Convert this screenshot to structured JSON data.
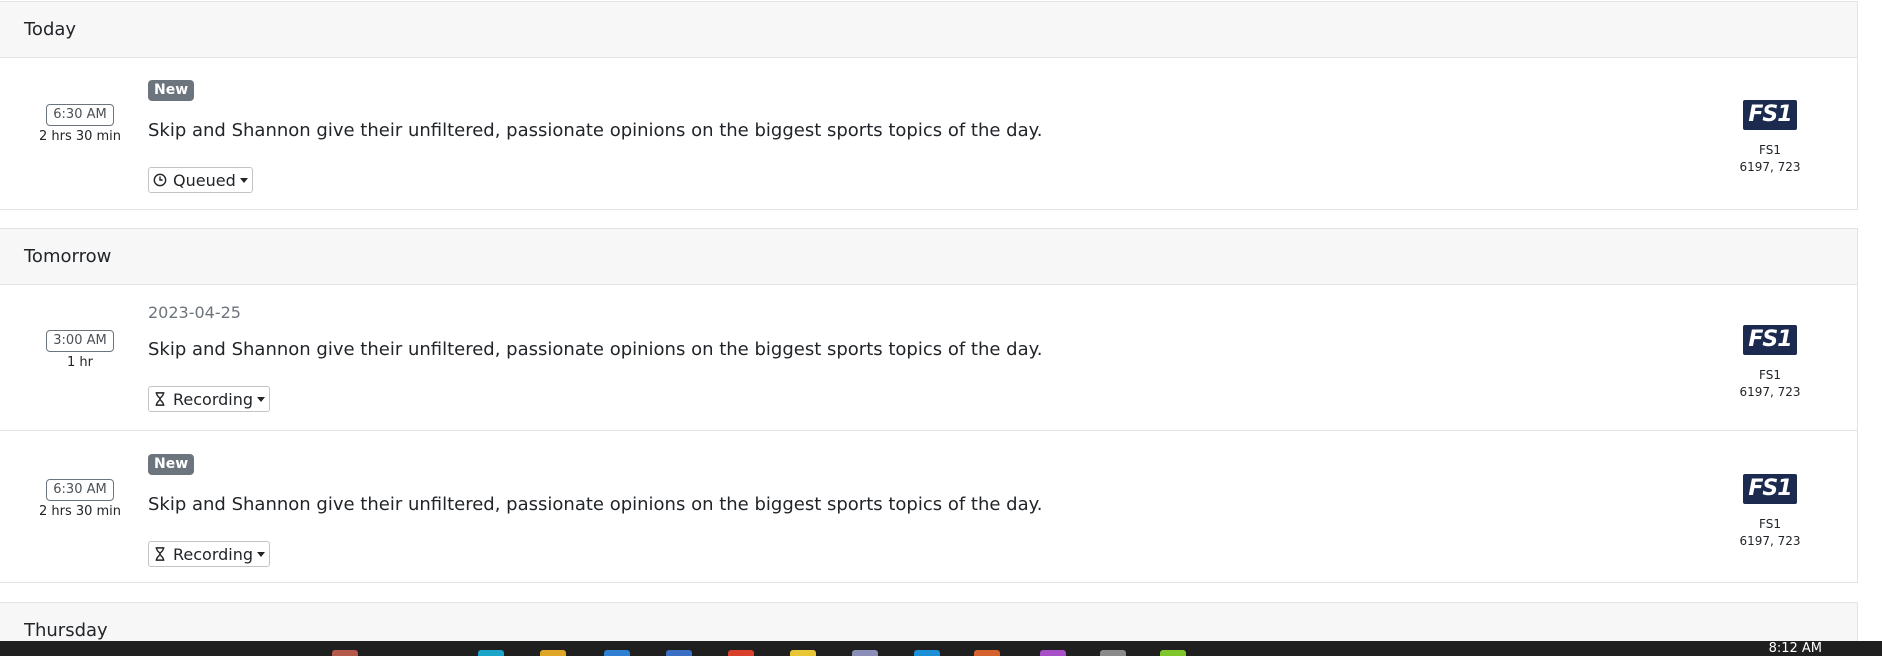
{
  "sections": [
    {
      "header": "Today",
      "rows": [
        {
          "time": "6:30 AM",
          "duration": "2 hrs 30 min",
          "tag": "New",
          "description": "Skip and Shannon give their unfiltered, passionate opinions on the biggest sports topics of the day.",
          "status": "Queued",
          "status_icon": "clock-icon",
          "channel_logo": "FS1",
          "channel_name": "FS1",
          "channel_numbers": "6197, 723"
        }
      ]
    },
    {
      "header": "Tomorrow",
      "rows": [
        {
          "time": "3:00 AM",
          "duration": "1 hr",
          "date": "2023-04-25",
          "description": "Skip and Shannon give their unfiltered, passionate opinions on the biggest sports topics of the day.",
          "status": "Recording",
          "status_icon": "hourglass-icon",
          "channel_logo": "FS1",
          "channel_name": "FS1",
          "channel_numbers": "6197, 723"
        },
        {
          "time": "6:30 AM",
          "duration": "2 hrs 30 min",
          "tag": "New",
          "description": "Skip and Shannon give their unfiltered, passionate opinions on the biggest sports topics of the day.",
          "status": "Recording",
          "status_icon": "hourglass-icon",
          "channel_logo": "FS1",
          "channel_name": "FS1",
          "channel_numbers": "6197, 723"
        }
      ]
    },
    {
      "header": "Thursday"
    }
  ],
  "taskbar": {
    "clock": "8:12 AM"
  },
  "colors": {
    "header_bg": "#f7f7f7",
    "badge_bg": "#6c757d",
    "logo_bg": "#1b2a4e",
    "taskbar_bg": "#1f1f1f"
  }
}
